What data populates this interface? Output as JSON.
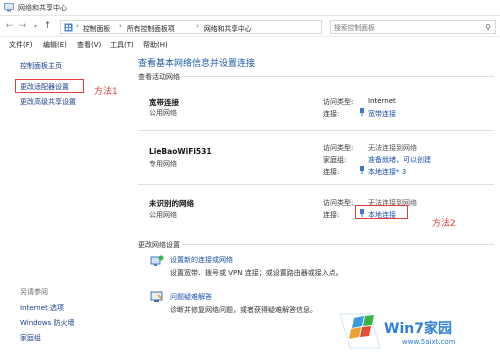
{
  "window": {
    "title": "网络和共享中心"
  },
  "nav": {
    "back": "←",
    "forward": "→",
    "up": "↑",
    "down": "▾",
    "refresh": "↻"
  },
  "breadcrumb": [
    "控制面板",
    "所有控制面板项",
    "网络和共享中心"
  ],
  "search": {
    "placeholder": "搜索控制面板"
  },
  "menu": [
    "文件(F)",
    "编辑(E)",
    "查看(V)",
    "工具(T)",
    "帮助(H)"
  ],
  "sidebar": {
    "items": [
      "控制面板主页",
      "更改适配器设置",
      "更改高级共享设置"
    ],
    "see_also_title": "另请参阅",
    "see_also": [
      "Internet 选项",
      "Windows 防火墙",
      "家庭组"
    ]
  },
  "annotations": {
    "method1": "方法1",
    "method2": "方法2"
  },
  "main": {
    "heading": "查看基本网络信息并设置连接",
    "active_title": "查看活动网络",
    "labels": {
      "access_type": "访问类型:",
      "connection": "连接:",
      "homegroup": "家庭组:"
    },
    "networks": [
      {
        "name": "宽带连接",
        "type": "公用网络",
        "access": "Internet",
        "connection": "宽带连接"
      },
      {
        "name": "LieBaoWiFi531",
        "type": "专用网络",
        "access": "无法连接到网络",
        "homegroup": "准备就绪，可以创建",
        "connection": "本地连接* 3"
      },
      {
        "name": "未识别的网络",
        "type": "公用网络",
        "access": "无法连接到网络",
        "connection": "本地连接"
      }
    ],
    "change_title": "更改网络设置",
    "tasks": [
      {
        "link": "设置新的连接或网络",
        "desc": "设置宽带、拨号或 VPN 连接；或设置路由器或接入点。"
      },
      {
        "link": "问题疑难解答",
        "desc": "诊断并修复网络问题，或者获得疑难解答信息。"
      }
    ]
  },
  "watermark": {
    "text": "Win7家园",
    "url": "www.5aixt.com"
  },
  "colors": {
    "link": "#1a4fb0",
    "heading": "#1e5aa8",
    "annotation": "#e23c3c",
    "watermark": "#2a7fd6"
  }
}
